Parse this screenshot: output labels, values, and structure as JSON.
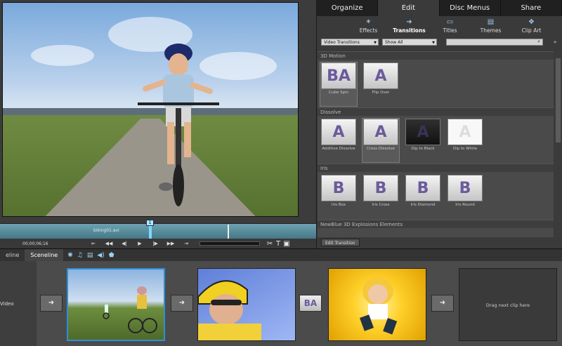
{
  "tabs": [
    {
      "label": "Organize"
    },
    {
      "label": "Edit"
    },
    {
      "label": "Disc Menus"
    },
    {
      "label": "Share"
    }
  ],
  "subtabs": [
    {
      "label": "Effects",
      "icon": "effects-icon"
    },
    {
      "label": "Transitions",
      "icon": "transitions-icon"
    },
    {
      "label": "Titles",
      "icon": "titles-icon"
    },
    {
      "label": "Themes",
      "icon": "themes-icon"
    },
    {
      "label": "Clip Art",
      "icon": "clip-art-icon"
    }
  ],
  "filters": {
    "category_value": "Video Transitions",
    "show_value": "Show All",
    "search_placeholder": ""
  },
  "categories": [
    {
      "name": "3D Motion",
      "items": [
        {
          "label": "Cube Spin",
          "glyph": "BA"
        },
        {
          "label": "Flip Over",
          "glyph": "A"
        }
      ]
    },
    {
      "name": "Dissolve",
      "items": [
        {
          "label": "Additive Dissolve",
          "glyph": "A"
        },
        {
          "label": "Cross Dissolve",
          "glyph": "A"
        },
        {
          "label": "Dip to Black",
          "glyph": "A"
        },
        {
          "label": "Dip to White",
          "glyph": "A"
        }
      ]
    },
    {
      "name": "Iris",
      "items": [
        {
          "label": "Iris Box",
          "glyph": "B"
        },
        {
          "label": "Iris Cross",
          "glyph": "B"
        },
        {
          "label": "Iris Diamond",
          "glyph": "B"
        },
        {
          "label": "Iris Round",
          "glyph": "B"
        }
      ]
    },
    {
      "name": "NewBlue 3D Explosions Elements",
      "items": []
    }
  ],
  "edit_transition_label": "Edit Transition",
  "preview": {
    "clip_label": "biking01.avi",
    "timecode": "00;00;06;16",
    "playhead_marker": "1"
  },
  "bottom_tabs": [
    {
      "label": "eline"
    },
    {
      "label": "Sceneline"
    }
  ],
  "sceneline": {
    "track_label": "Video",
    "drag_hint": "Drag next clip here",
    "transition_glyph": "BA"
  }
}
